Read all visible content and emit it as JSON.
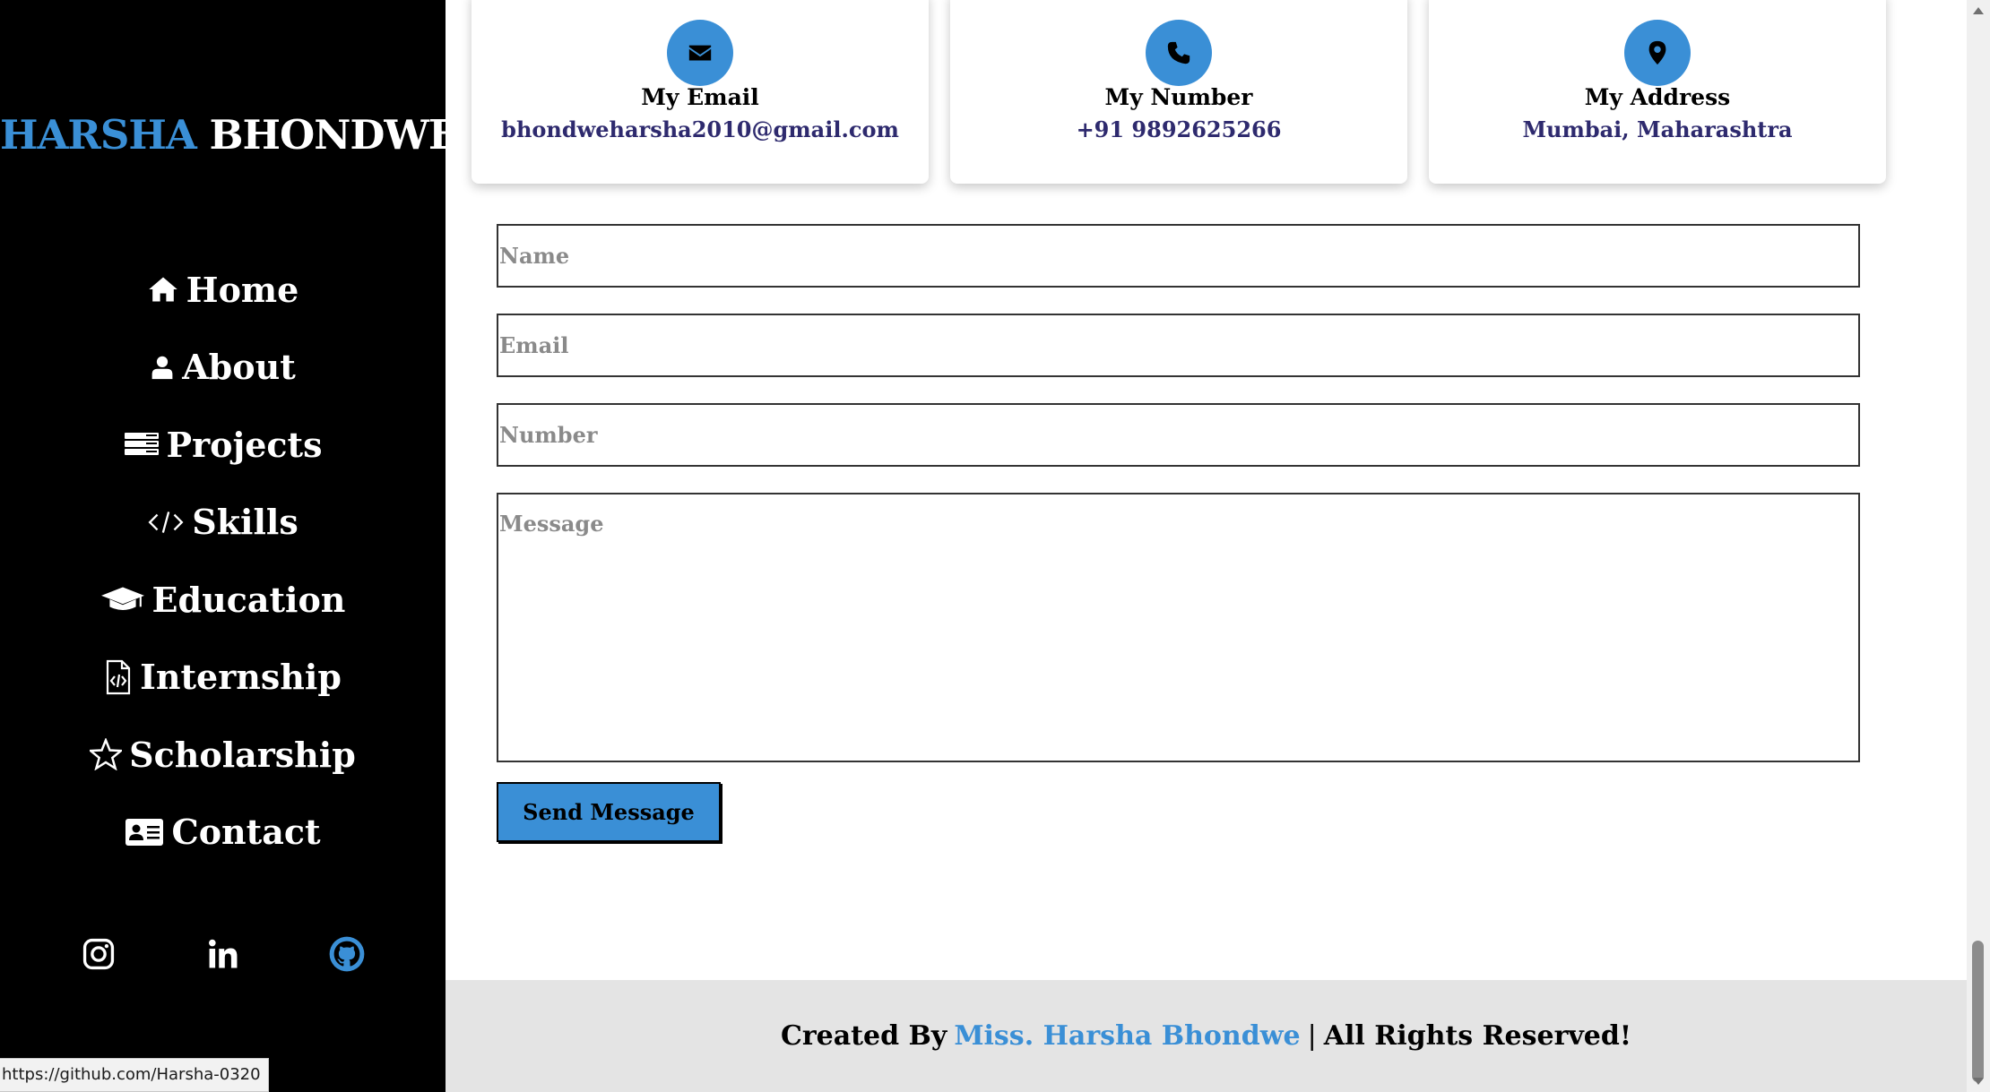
{
  "sidebar": {
    "logo_first": "HARSHA",
    "logo_last": "BHONDWE",
    "nav": [
      {
        "label": "Home",
        "icon": "home-icon"
      },
      {
        "label": "About",
        "icon": "user-icon"
      },
      {
        "label": "Projects",
        "icon": "projects-icon"
      },
      {
        "label": "Skills",
        "icon": "code-icon"
      },
      {
        "label": "Education",
        "icon": "graduation-cap-icon"
      },
      {
        "label": "Internship",
        "icon": "code-file-icon"
      },
      {
        "label": "Scholarship",
        "icon": "star-icon"
      },
      {
        "label": "Contact",
        "icon": "contact-card-icon"
      }
    ],
    "socials": [
      "instagram-icon",
      "linkedin-icon",
      "github-icon"
    ],
    "status_url": "https://github.com/Harsha-0320"
  },
  "contact_cards": [
    {
      "title": "My Email",
      "value": "bhondweharsha2010@gmail.com",
      "icon": "envelope-icon"
    },
    {
      "title": "My Number",
      "value": "+91 9892625266",
      "icon": "phone-icon"
    },
    {
      "title": "My Address",
      "value": "Mumbai, Maharashtra",
      "icon": "location-pin-icon"
    }
  ],
  "form": {
    "name_placeholder": "Name",
    "email_placeholder": "Email",
    "number_placeholder": "Number",
    "message_placeholder": "Message",
    "submit_label": "Send Message"
  },
  "footer": {
    "prefix": "Created By",
    "author": "Miss. Harsha Bhondwe",
    "separator": "|",
    "suffix": "All Rights Reserved!"
  },
  "colors": {
    "accent": "#3a8fd6",
    "sidebar_bg": "#000000",
    "card_value": "#2e2a6e",
    "footer_bg": "#e4e4e4"
  }
}
